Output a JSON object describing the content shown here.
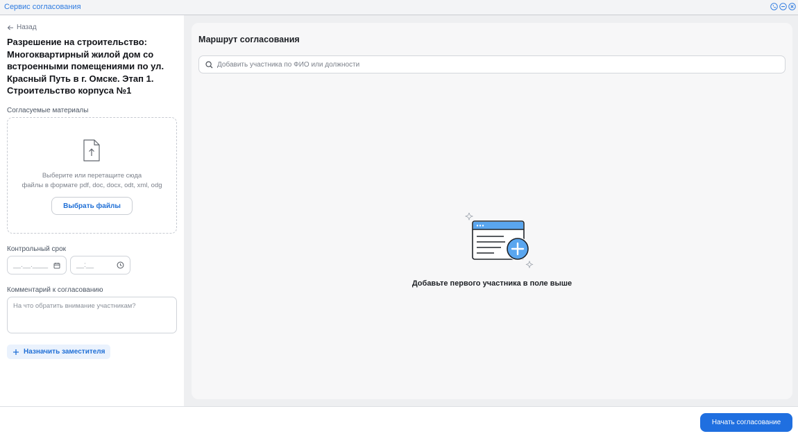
{
  "window": {
    "title": "Сервис согласования",
    "controls": [
      "phone-icon",
      "minimize-icon",
      "close-icon"
    ]
  },
  "left": {
    "back_label": "Назад",
    "document_title": "Разрешение на строительство: Многоквартирный жилой дом со встроенными помещениями по ул. Красный Путь в г. Омске. Этап 1. Строительство корпуса №1",
    "materials_label": "Согласуемые материалы",
    "dropzone": {
      "hint_line1": "Выберите или перетащите сюда",
      "hint_line2": "файлы в формате pdf, doc, docx, odt, xml, odg",
      "choose_button": "Выбрать файлы"
    },
    "deadline_label": "Контрольный срок",
    "date_placeholder": "__.__.____",
    "time_placeholder": "__:__",
    "comment_label": "Комментарий к согласованию",
    "comment_placeholder": "На что обратить внимание участникам?",
    "deputy_button": "Назначить заместителя"
  },
  "route": {
    "title": "Маршрут согласования",
    "search_placeholder": "Добавить участника по ФИО или должности",
    "empty_text": "Добавьте первого участника в поле выше"
  },
  "footer": {
    "start_button": "Начать согласование"
  },
  "colors": {
    "accent": "#1f6fe0",
    "link": "#1f6fd6",
    "panel_bg": "#eeeff1"
  }
}
